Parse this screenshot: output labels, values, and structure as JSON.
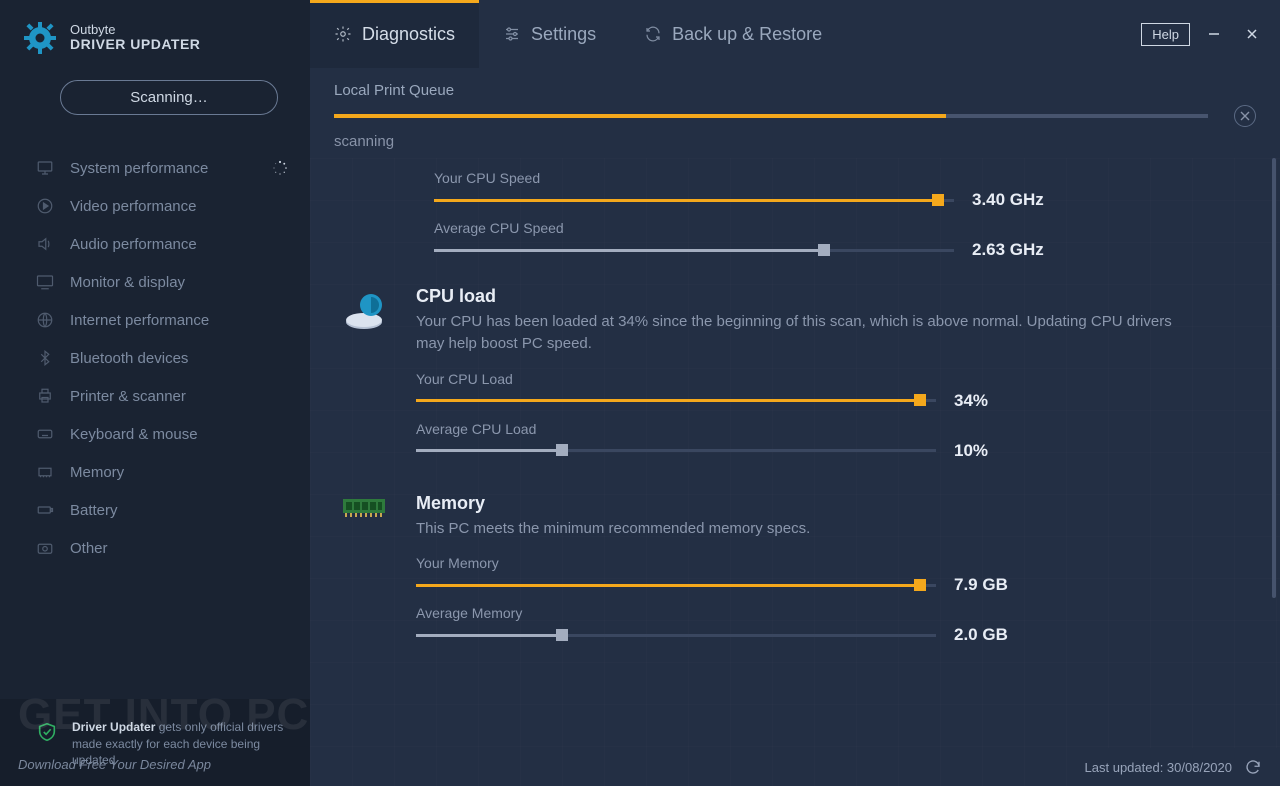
{
  "brand": {
    "name": "Outbyte",
    "product": "DRIVER UPDATER"
  },
  "scan_button": "Scanning…",
  "sidebar": {
    "items": [
      {
        "label": "System performance",
        "icon": "monitor",
        "spinning": true
      },
      {
        "label": "Video performance",
        "icon": "play"
      },
      {
        "label": "Audio performance",
        "icon": "speaker"
      },
      {
        "label": "Monitor & display",
        "icon": "display"
      },
      {
        "label": "Internet performance",
        "icon": "globe"
      },
      {
        "label": "Bluetooth devices",
        "icon": "bluetooth"
      },
      {
        "label": "Printer & scanner",
        "icon": "printer"
      },
      {
        "label": "Keyboard & mouse",
        "icon": "keyboard"
      },
      {
        "label": "Memory",
        "icon": "memory"
      },
      {
        "label": "Battery",
        "icon": "battery"
      },
      {
        "label": "Other",
        "icon": "camera"
      }
    ],
    "footer_bold": "Driver Updater",
    "footer_rest": " gets only official drivers made exactly for each device being updated"
  },
  "tabs": {
    "diagnostics": "Diagnostics",
    "settings": "Settings",
    "backup": "Back up & Restore"
  },
  "titlebar": {
    "help": "Help"
  },
  "progress": {
    "title": "Local Print Queue",
    "status": "scanning",
    "percent": 70
  },
  "cpu_speed": {
    "your_label": "Your CPU Speed",
    "your_value": "3.40 GHz",
    "your_pct": 97,
    "avg_label": "Average CPU Speed",
    "avg_value": "2.63 GHz",
    "avg_pct": 75
  },
  "cpu_load": {
    "title": "CPU load",
    "desc": "Your CPU has been loaded at 34% since the beginning of this scan, which is above normal. Updating CPU drivers may help boost PC speed.",
    "your_label": "Your CPU Load",
    "your_value": "34%",
    "your_pct": 97,
    "avg_label": "Average CPU Load",
    "avg_value": "10%",
    "avg_pct": 28
  },
  "memory": {
    "title": "Memory",
    "desc": "This PC meets the minimum recommended memory specs.",
    "your_label": "Your Memory",
    "your_value": "7.9 GB",
    "your_pct": 97,
    "avg_label": "Average Memory",
    "avg_value": "2.0 GB",
    "avg_pct": 28
  },
  "footer": {
    "last_updated": "Last updated: 30/08/2020"
  },
  "watermark": {
    "big": "GET INTO PC",
    "small": "Download Free Your Desired App"
  },
  "colors": {
    "accent": "#f4a81c"
  }
}
